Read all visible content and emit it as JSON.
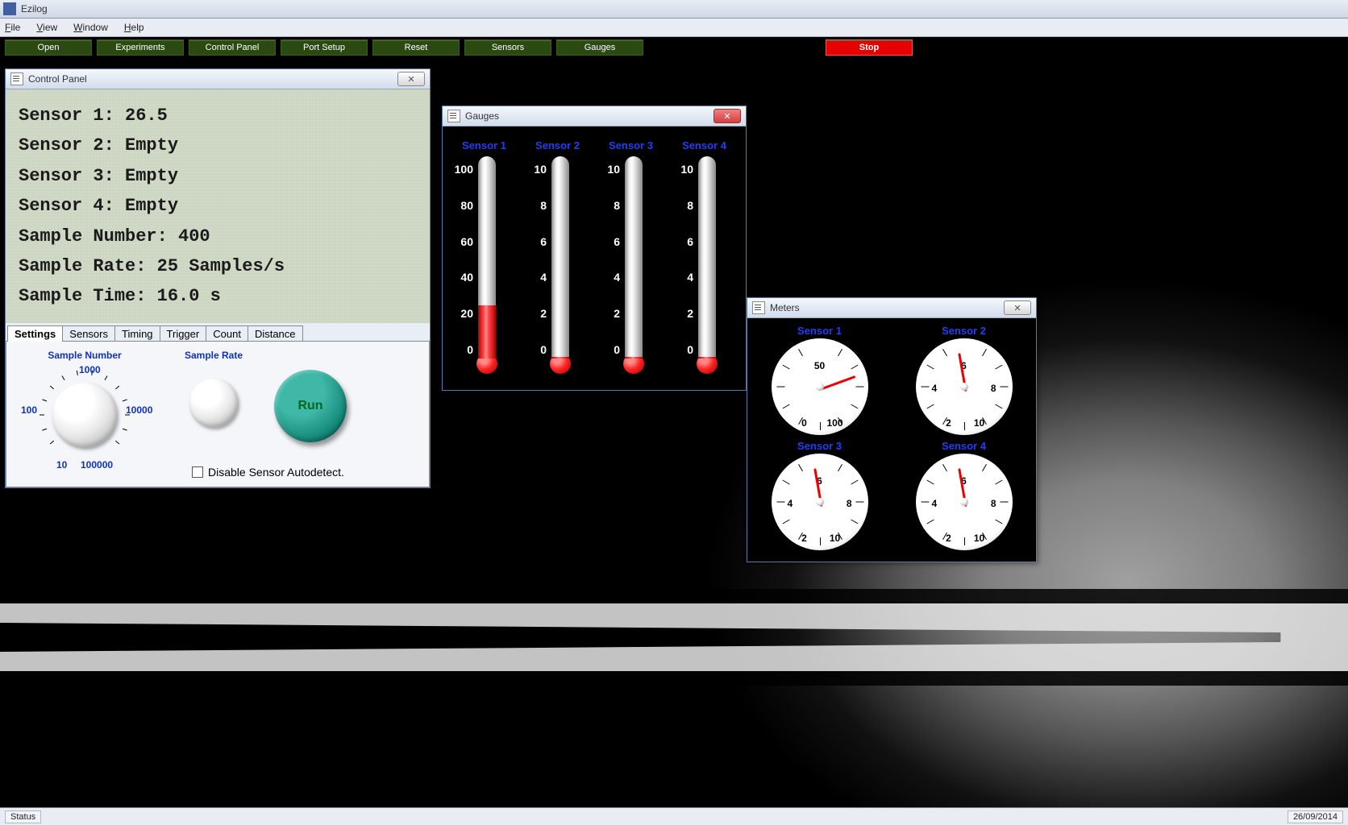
{
  "app_title": "Ezilog",
  "menubar": [
    "File",
    "View",
    "Window",
    "Help"
  ],
  "toolbar": [
    "Open",
    "Experiments",
    "Control Panel",
    "Port Setup",
    "Reset",
    "Sensors",
    "Gauges"
  ],
  "stop_label": "Stop",
  "statusbar": {
    "left": "Status",
    "right": "26/09/2014"
  },
  "control_panel": {
    "title": "Control Panel",
    "lcd_lines": [
      "Sensor 1: 26.5",
      "Sensor 2: Empty",
      "Sensor 3: Empty",
      "Sensor 4: Empty",
      "Sample Number: 400",
      "Sample Rate: 25 Samples/s",
      "Sample Time: 16.0 s"
    ],
    "tabs": [
      "Settings",
      "Sensors",
      "Timing",
      "Trigger",
      "Count",
      "Distance"
    ],
    "active_tab": 0,
    "settings": {
      "sample_number_label": "Sample Number",
      "sample_number_scale": [
        "10",
        "100",
        "1000",
        "10000",
        "100000"
      ],
      "sample_rate_label": "Sample Rate",
      "run_label": "Run",
      "disable_autodetect_label": "Disable Sensor Autodetect.",
      "disable_autodetect_checked": false
    }
  },
  "gauges_window": {
    "title": "Gauges",
    "columns": [
      {
        "label": "Sensor 1",
        "scale": [
          "100",
          "80",
          "60",
          "40",
          "20",
          "0"
        ],
        "max": 100,
        "value": 26.5
      },
      {
        "label": "Sensor 2",
        "scale": [
          "10",
          "8",
          "6",
          "4",
          "2",
          "0"
        ],
        "max": 10,
        "value": 0
      },
      {
        "label": "Sensor 3",
        "scale": [
          "10",
          "8",
          "6",
          "4",
          "2",
          "0"
        ],
        "max": 10,
        "value": 0
      },
      {
        "label": "Sensor 4",
        "scale": [
          "10",
          "8",
          "6",
          "4",
          "2",
          "0"
        ],
        "max": 10,
        "value": 0
      }
    ]
  },
  "meters_window": {
    "title": "Meters",
    "dials": [
      {
        "label": "Sensor 1",
        "scale": [
          "0",
          "50",
          "100"
        ],
        "max": 100,
        "value": 26.5,
        "needle_deg": -110
      },
      {
        "label": "Sensor 2",
        "scale": [
          "2",
          "4",
          "6",
          "8",
          "10"
        ],
        "max": 10,
        "value": 0,
        "needle_deg": 170
      },
      {
        "label": "Sensor 3",
        "scale": [
          "2",
          "4",
          "6",
          "8",
          "10"
        ],
        "max": 10,
        "value": 0,
        "needle_deg": 170
      },
      {
        "label": "Sensor 4",
        "scale": [
          "2",
          "4",
          "6",
          "8",
          "10"
        ],
        "max": 10,
        "value": 0,
        "needle_deg": 170
      }
    ]
  }
}
